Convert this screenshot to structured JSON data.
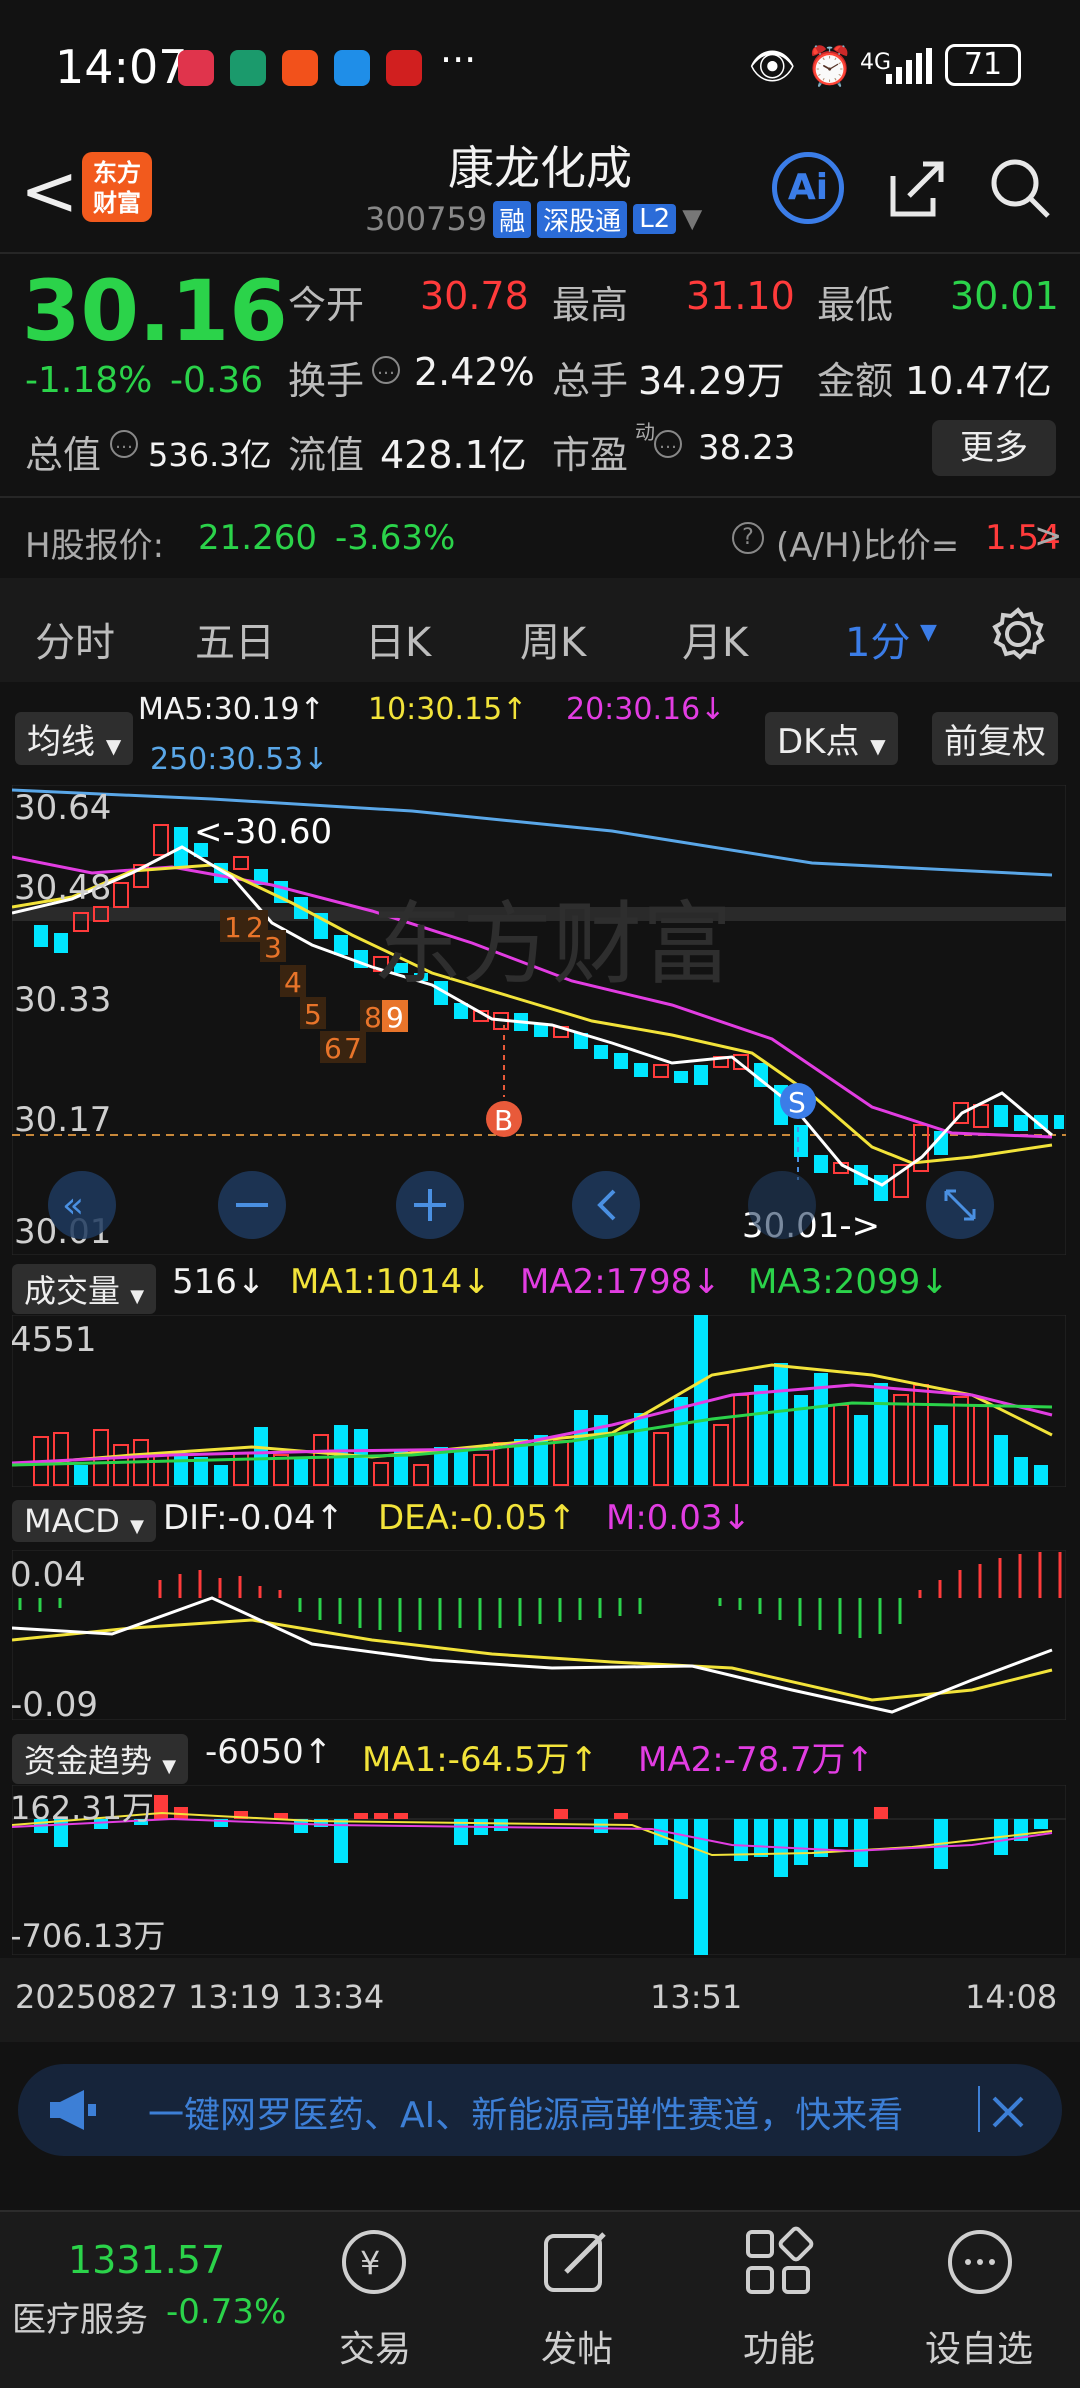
{
  "status": {
    "time": "14:07",
    "battery": "71",
    "network": "4G"
  },
  "header": {
    "back": "<",
    "logo_line1": "东方",
    "logo_line2": "财富",
    "title": "康龙化成",
    "code": "300759",
    "tag1": "融",
    "tag2": "深股通",
    "tag3": "L2",
    "ai": "Ai"
  },
  "quote": {
    "price": "30.16",
    "pct": "-1.18%",
    "chg": "-0.36",
    "open_label": "今开",
    "open": "30.78",
    "high_label": "最高",
    "high": "31.10",
    "low_label": "最低",
    "low": "30.01",
    "turnover_label": "换手",
    "turnover": "2.42%",
    "volume_label": "总手",
    "volume": "34.29万",
    "amount_label": "金额",
    "amount": "10.47亿",
    "mcap_label": "总值",
    "mcap": "536.3亿",
    "float_label": "流值",
    "float": "428.1亿",
    "pe_label": "市盈",
    "pe_sup": "动",
    "pe": "38.23",
    "more": "更多"
  },
  "hshare": {
    "label": "H股报价:",
    "price": "21.260",
    "pct": "-3.63%",
    "ratio_label": "(A/H)比价=",
    "ratio": "1.54"
  },
  "tabs": [
    "分时",
    "五日",
    "日K",
    "周K",
    "月K",
    "1分"
  ],
  "ma": {
    "selector": "均线",
    "ma5": "MA5:30.19↑",
    "ma10": "10:30.15↑",
    "ma20": "20:30.16↓",
    "ma250": "250:30.53↓",
    "dk": "DK点",
    "adjust": "前复权"
  },
  "price_axis": {
    "p1": "30.64",
    "p2": "30.48",
    "p3": "30.33",
    "p4": "30.17",
    "p5": "30.01"
  },
  "annotations": {
    "high": "<-30.60",
    "low": "30.01->",
    "buy": "B",
    "sell": "S",
    "nums": [
      "1",
      "2",
      "3",
      "4",
      "5",
      "6",
      "7",
      "8",
      "9"
    ]
  },
  "volume": {
    "selector": "成交量",
    "cur": "516↓",
    "ma1": "MA1:1014↓",
    "ma2": "MA2:1798↓",
    "ma3": "MA3:2099↓",
    "max": "4551"
  },
  "macd": {
    "selector": "MACD",
    "dif": "DIF:-0.04↑",
    "dea": "DEA:-0.05↑",
    "m": "M:0.03↓",
    "top": "0.04",
    "bottom": "-0.09"
  },
  "fund": {
    "selector": "资金趋势",
    "cur": "-6050↑",
    "ma1": "MA1:-64.5万↑",
    "ma2": "MA2:-78.7万↑",
    "top": "162.31万",
    "bottom": "-706.13万"
  },
  "time_axis": {
    "t0": "20250827 13:19",
    "t1": "13:34",
    "t2": "13:51",
    "t3": "14:08"
  },
  "banner": {
    "text": "一键网罗医药、AI、新能源高弹性赛道，快来看"
  },
  "bottom": {
    "index_value": "1331.57",
    "index_name": "医疗服务",
    "index_pct": "-0.73%",
    "items": [
      "交易",
      "发帖",
      "功能",
      "设自选"
    ]
  },
  "colors": {
    "up": "#ff3b3b",
    "down": "#2bd34a",
    "accent": "#3b7de8",
    "ma5": "#ffffff",
    "ma10": "#f2e33a",
    "ma20": "#e23de2",
    "ma250": "#5aa7e8"
  }
}
